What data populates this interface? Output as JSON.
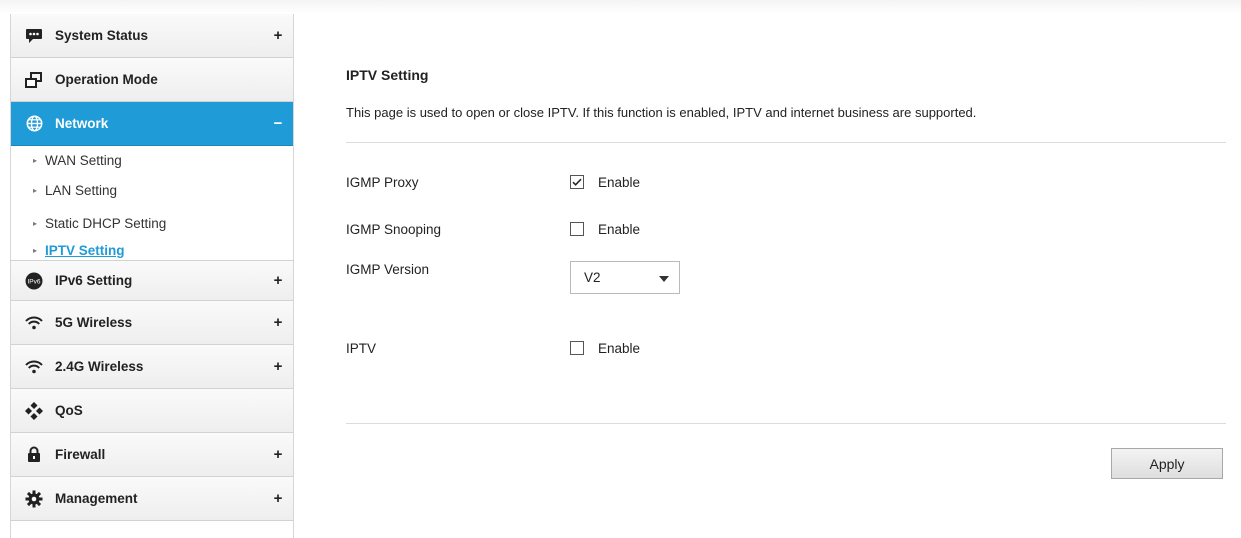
{
  "sidebar": {
    "items": [
      {
        "label": "System Status",
        "toggle": "+",
        "icon": "chat-icon"
      },
      {
        "label": "Operation Mode",
        "toggle": "",
        "icon": "windows-icon"
      },
      {
        "label": "Network",
        "toggle": "−",
        "icon": "globe-icon"
      },
      {
        "label": "IPv6 Setting",
        "toggle": "+",
        "icon": "ipv6-icon"
      },
      {
        "label": "5G Wireless",
        "toggle": "+",
        "icon": "wifi-icon"
      },
      {
        "label": "2.4G Wireless",
        "toggle": "+",
        "icon": "wifi-icon"
      },
      {
        "label": "QoS",
        "toggle": "",
        "icon": "qos-icon"
      },
      {
        "label": "Firewall",
        "toggle": "+",
        "icon": "lock-icon"
      },
      {
        "label": "Management",
        "toggle": "+",
        "icon": "gear-icon"
      }
    ],
    "network_sub": [
      {
        "label": "WAN Setting"
      },
      {
        "label": "LAN Setting"
      },
      {
        "label": "Static DHCP Setting"
      },
      {
        "label": "IPTV Setting"
      }
    ],
    "ipv6_badge": "IPv6",
    "active_color": "#1f9bd7"
  },
  "main": {
    "title": "IPTV Setting",
    "description": "This page is used to open or close IPTV. If this function is enabled, IPTV and internet business are supported.",
    "igmp_proxy": {
      "label": "IGMP Proxy",
      "option": "Enable",
      "checked": true
    },
    "igmp_snooping": {
      "label": "IGMP Snooping",
      "option": "Enable",
      "checked": false
    },
    "igmp_version": {
      "label": "IGMP Version",
      "value": "V2"
    },
    "iptv": {
      "label": "IPTV",
      "option": "Enable",
      "checked": false
    },
    "apply_label": "Apply"
  }
}
